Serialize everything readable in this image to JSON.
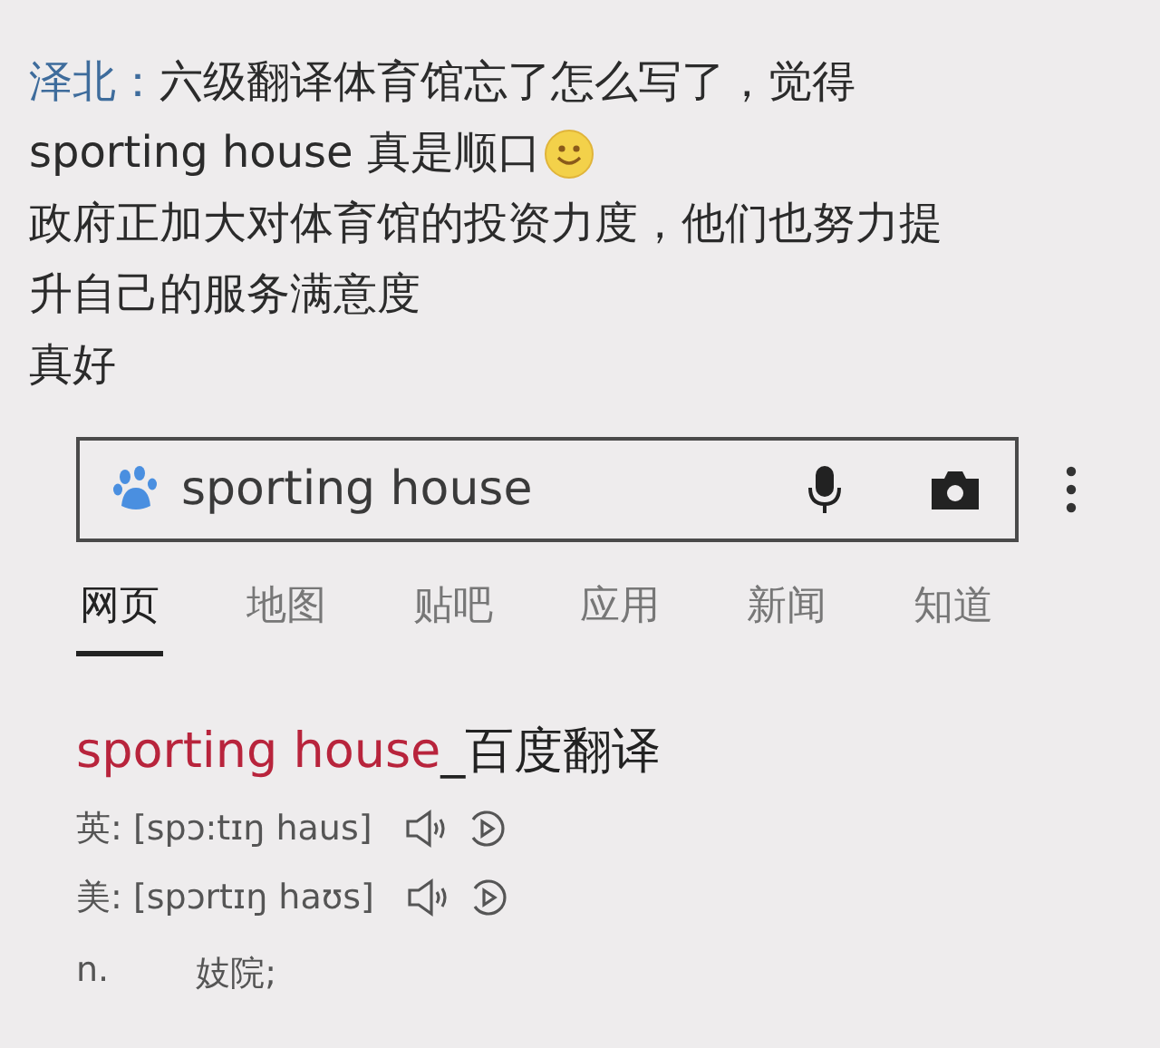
{
  "comment": {
    "author": "泽北",
    "separator": "：",
    "lines": [
      {
        "text": "六级翻译体育馆忘了怎么写了，觉得",
        "emoji": false
      },
      {
        "text": "sporting house 真是顺口",
        "emoji": true
      },
      {
        "text": "政府正加大对体育馆的投资力度，他们也努力提",
        "emoji": false
      },
      {
        "text": "升自己的服务满意度",
        "emoji": false
      },
      {
        "text": "真好",
        "emoji": false
      }
    ]
  },
  "search": {
    "value": "sporting house"
  },
  "tabs": [
    {
      "label": "网页",
      "selected": true
    },
    {
      "label": "地图",
      "selected": false
    },
    {
      "label": "贴吧",
      "selected": false
    },
    {
      "label": "应用",
      "selected": false
    },
    {
      "label": "新闻",
      "selected": false
    },
    {
      "label": "知道",
      "selected": false
    }
  ],
  "result": {
    "title_term": "sporting house",
    "title_suffix": "_百度翻译",
    "pronunciations": [
      {
        "text": "英: [spɔ:tɪŋ haus]"
      },
      {
        "text": "美: [spɔrtɪŋ haʊs]"
      }
    ],
    "definitions": [
      {
        "pos": "n.",
        "meaning": "妓院;"
      }
    ]
  }
}
